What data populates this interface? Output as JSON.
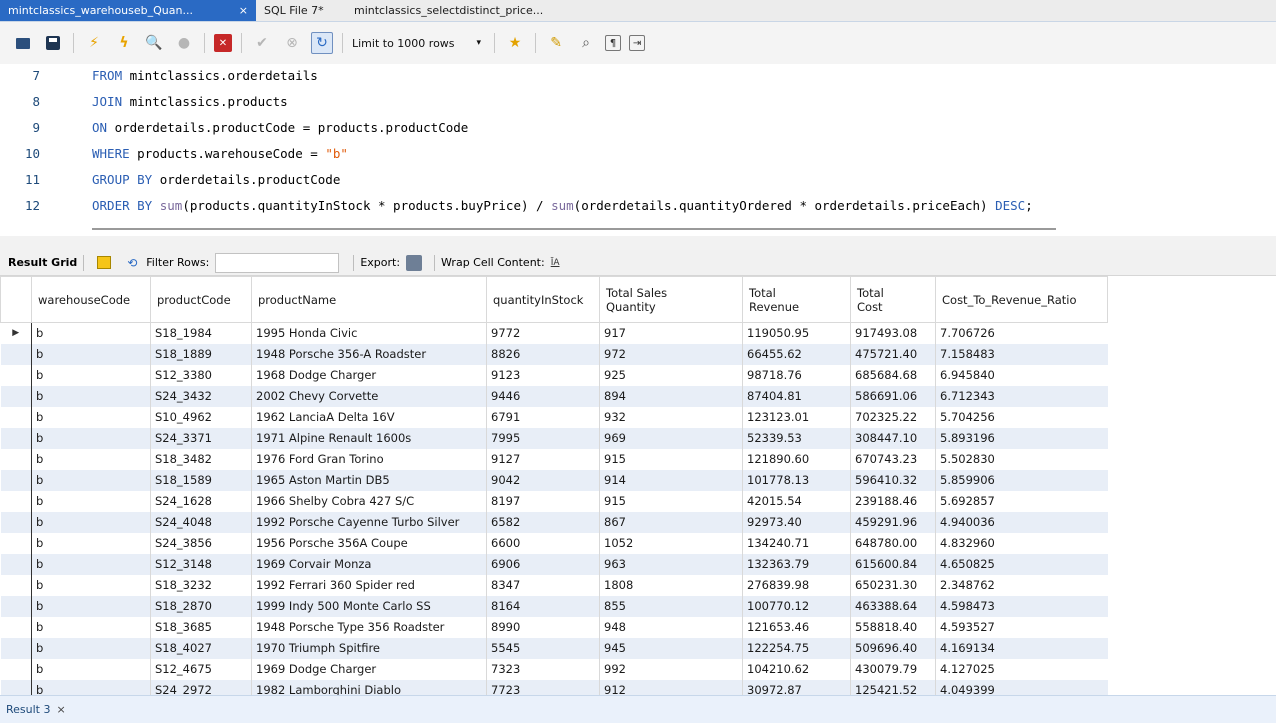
{
  "tabs": [
    {
      "label": "mintclassics_warehouseb_Quan...",
      "active": true
    },
    {
      "label": "SQL File 7*",
      "active": false
    },
    {
      "label": "mintclassics_selectdistinct_price...",
      "active": false
    }
  ],
  "tab_close_glyph": "×",
  "toolbar": {
    "limit_label": "Limit to 1000 rows",
    "dropdown_glyph": "▾"
  },
  "editor": {
    "lines": [
      {
        "num": "7",
        "segments": [
          {
            "t": "kw",
            "v": "FROM"
          },
          {
            "t": "p",
            "v": " mintclassics.orderdetails"
          }
        ]
      },
      {
        "num": "8",
        "segments": [
          {
            "t": "kw",
            "v": "JOIN"
          },
          {
            "t": "p",
            "v": " mintclassics.products"
          }
        ]
      },
      {
        "num": "9",
        "segments": [
          {
            "t": "kw",
            "v": "ON"
          },
          {
            "t": "p",
            "v": " orderdetails.productCode = products.productCode"
          }
        ]
      },
      {
        "num": "10",
        "segments": [
          {
            "t": "kw",
            "v": "WHERE"
          },
          {
            "t": "p",
            "v": " products.warehouseCode = "
          },
          {
            "t": "str",
            "v": "\"b\""
          }
        ]
      },
      {
        "num": "11",
        "segments": [
          {
            "t": "kw",
            "v": "GROUP BY"
          },
          {
            "t": "p",
            "v": " orderdetails.productCode"
          }
        ]
      },
      {
        "num": "12",
        "segments": [
          {
            "t": "kw",
            "v": "ORDER BY"
          },
          {
            "t": "p",
            "v": " "
          },
          {
            "t": "fn",
            "v": "sum"
          },
          {
            "t": "p",
            "v": "(products.quantityInStock * products.buyPrice) / "
          },
          {
            "t": "fn",
            "v": "sum"
          },
          {
            "t": "p",
            "v": "(orderdetails.quantityOrdered * orderdetails.priceEach) "
          },
          {
            "t": "kw",
            "v": "DESC"
          },
          {
            "t": "p",
            "v": ";"
          }
        ]
      }
    ]
  },
  "result_toolbar": {
    "result_grid_label": "Result Grid",
    "filter_label": "Filter Rows:",
    "filter_value": "",
    "export_label": "Export:",
    "wrap_label": "Wrap Cell Content:",
    "wrap_glyph": "ĪA"
  },
  "grid": {
    "columns": [
      "warehouseCode",
      "productCode",
      "productName",
      "quantityInStock",
      "Total Sales\nQuantity",
      "Total\nRevenue",
      "Total\nCost",
      "Cost_To_Revenue_Ratio"
    ],
    "row_marker_glyph": "▶",
    "rows": [
      [
        "b",
        "S18_1984",
        "1995 Honda Civic",
        "9772",
        "917",
        "119050.95",
        "917493.08",
        "7.706726"
      ],
      [
        "b",
        "S18_1889",
        "1948 Porsche 356-A Roadster",
        "8826",
        "972",
        "66455.62",
        "475721.40",
        "7.158483"
      ],
      [
        "b",
        "S12_3380",
        "1968 Dodge Charger",
        "9123",
        "925",
        "98718.76",
        "685684.68",
        "6.945840"
      ],
      [
        "b",
        "S24_3432",
        "2002 Chevy Corvette",
        "9446",
        "894",
        "87404.81",
        "586691.06",
        "6.712343"
      ],
      [
        "b",
        "S10_4962",
        "1962 LanciaA Delta 16V",
        "6791",
        "932",
        "123123.01",
        "702325.22",
        "5.704256"
      ],
      [
        "b",
        "S24_3371",
        "1971 Alpine Renault 1600s",
        "7995",
        "969",
        "52339.53",
        "308447.10",
        "5.893196"
      ],
      [
        "b",
        "S18_3482",
        "1976 Ford Gran Torino",
        "9127",
        "915",
        "121890.60",
        "670743.23",
        "5.502830"
      ],
      [
        "b",
        "S18_1589",
        "1965 Aston Martin DB5",
        "9042",
        "914",
        "101778.13",
        "596410.32",
        "5.859906"
      ],
      [
        "b",
        "S24_1628",
        "1966 Shelby Cobra 427 S/C",
        "8197",
        "915",
        "42015.54",
        "239188.46",
        "5.692857"
      ],
      [
        "b",
        "S24_4048",
        "1992 Porsche Cayenne Turbo Silver",
        "6582",
        "867",
        "92973.40",
        "459291.96",
        "4.940036"
      ],
      [
        "b",
        "S24_3856",
        "1956 Porsche 356A Coupe",
        "6600",
        "1052",
        "134240.71",
        "648780.00",
        "4.832960"
      ],
      [
        "b",
        "S12_3148",
        "1969 Corvair Monza",
        "6906",
        "963",
        "132363.79",
        "615600.84",
        "4.650825"
      ],
      [
        "b",
        "S18_3232",
        "1992 Ferrari 360 Spider red",
        "8347",
        "1808",
        "276839.98",
        "650231.30",
        "2.348762"
      ],
      [
        "b",
        "S18_2870",
        "1999 Indy 500 Monte Carlo SS",
        "8164",
        "855",
        "100770.12",
        "463388.64",
        "4.598473"
      ],
      [
        "b",
        "S18_3685",
        "1948 Porsche Type 356 Roadster",
        "8990",
        "948",
        "121653.46",
        "558818.40",
        "4.593527"
      ],
      [
        "b",
        "S18_4027",
        "1970 Triumph Spitfire",
        "5545",
        "945",
        "122254.75",
        "509696.40",
        "4.169134"
      ],
      [
        "b",
        "S12_4675",
        "1969 Dodge Charger",
        "7323",
        "992",
        "104210.62",
        "430079.79",
        "4.127025"
      ],
      [
        "b",
        "S24_2972",
        "1982 Lamborghini Diablo",
        "7723",
        "912",
        "30972.87",
        "125421.52",
        "4.049399"
      ]
    ]
  },
  "status": {
    "result_tab_label": "Result 3",
    "close_glyph": "×"
  },
  "colors": {
    "active_tab": "#2a6ac4",
    "keyword": "#2b5eb3",
    "string": "#e05a0a",
    "alt_row": "#e8eef7"
  }
}
